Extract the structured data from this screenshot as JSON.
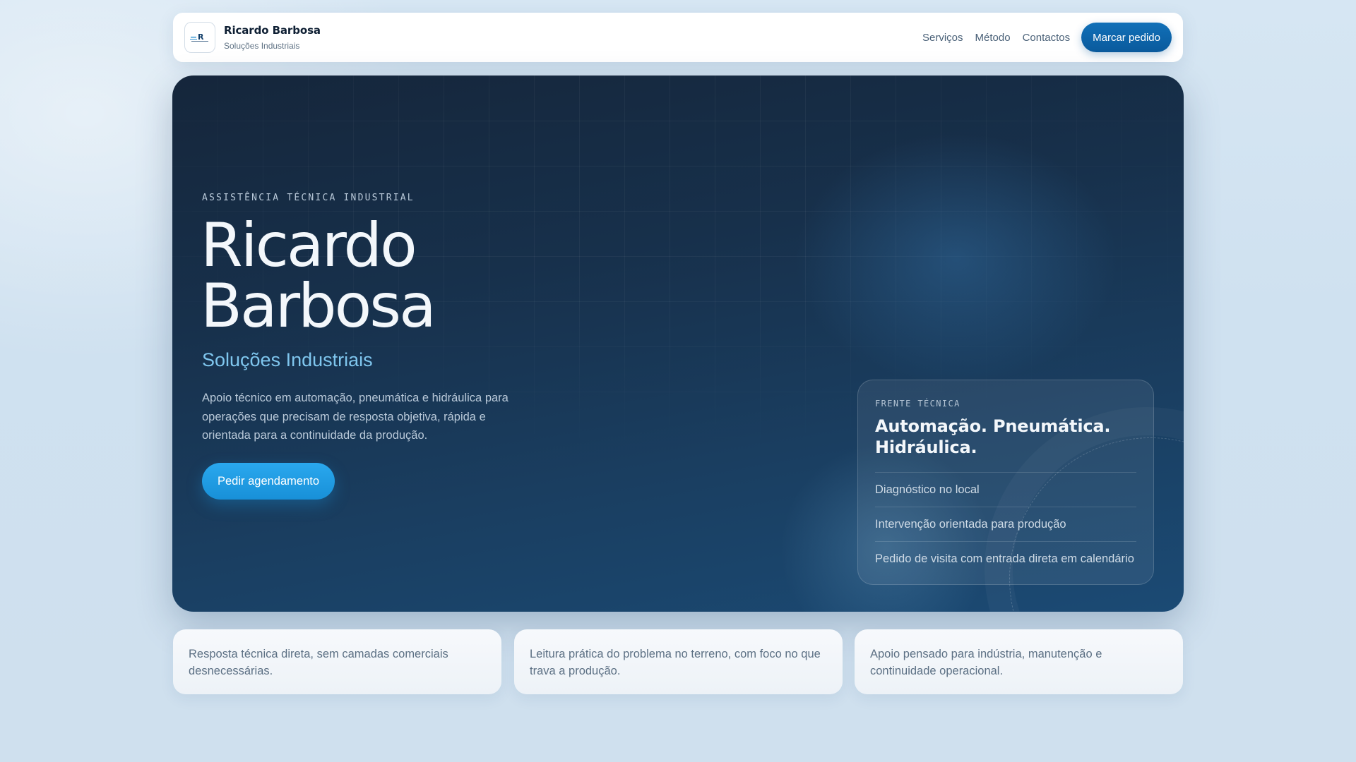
{
  "header": {
    "brand_name": "Ricardo Barbosa",
    "brand_sub": "Soluções Industriais",
    "nav": [
      "Serviços",
      "Método",
      "Contactos"
    ],
    "cta": "Marcar pedido"
  },
  "hero": {
    "eyebrow": "ASSISTÊNCIA TÉCNICA INDUSTRIAL",
    "title_line1": "Ricardo",
    "title_line2": "Barbosa",
    "subtitle": "Soluções Industriais",
    "description": "Apoio técnico em automação, pneumática e hidráulica para operações que precisam de resposta objetiva, rápida e orientada para a continuidade da produção.",
    "button": "Pedir agendamento"
  },
  "tech_card": {
    "eyebrow": "FRENTE TÉCNICA",
    "title": "Automação. Pneumática. Hidráulica.",
    "items": [
      "Diagnóstico no local",
      "Intervenção orientada para produção",
      "Pedido de visita com entrada direta em calendário"
    ]
  },
  "features": [
    "Resposta técnica direta, sem camadas comerciais desnecessárias.",
    "Leitura prática do problema no terreno, com foco no que trava a produção.",
    "Apoio pensado para indústria, manutenção e continuidade operacional."
  ],
  "colors": {
    "accent": "#0a5a9c",
    "hero_bg": "#17304b",
    "subtitle": "#7fc6ee",
    "button": "#1890d8"
  }
}
